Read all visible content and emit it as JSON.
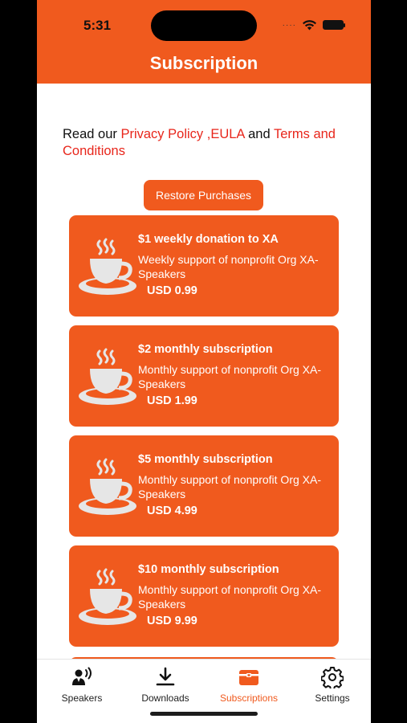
{
  "status_bar": {
    "time": "5:31",
    "signal": "····"
  },
  "header": {
    "title": "Subscription"
  },
  "legal": {
    "prefix": "Read our ",
    "privacy_link": "Privacy Policy ,EULA",
    "connector": " and ",
    "terms_link": "Terms and Conditions"
  },
  "restore_button": "Restore Purchases",
  "plans": [
    {
      "title": "$1 weekly donation to XA",
      "description": "Weekly support of nonprofit Org XA-Speakers",
      "price": "USD 0.99"
    },
    {
      "title": "$2 monthly subscription",
      "description": "Monthly support of nonprofit Org XA-Speakers",
      "price": "USD 1.99"
    },
    {
      "title": "$5 monthly subscription",
      "description": "Monthly support of nonprofit Org XA-Speakers",
      "price": "USD 4.99"
    },
    {
      "title": "$10 monthly subscription",
      "description": "Monthly support of nonprofit Org XA-Speakers",
      "price": "USD 9.99"
    }
  ],
  "tabs": [
    {
      "label": "Speakers",
      "icon": "speakers-icon"
    },
    {
      "label": "Downloads",
      "icon": "download-icon"
    },
    {
      "label": "Subscriptions",
      "icon": "subscriptions-icon",
      "active": true
    },
    {
      "label": "Settings",
      "icon": "gear-icon"
    }
  ],
  "colors": {
    "accent": "#F05A1E",
    "link": "#E8261B",
    "cup": "#E6E6E6"
  }
}
